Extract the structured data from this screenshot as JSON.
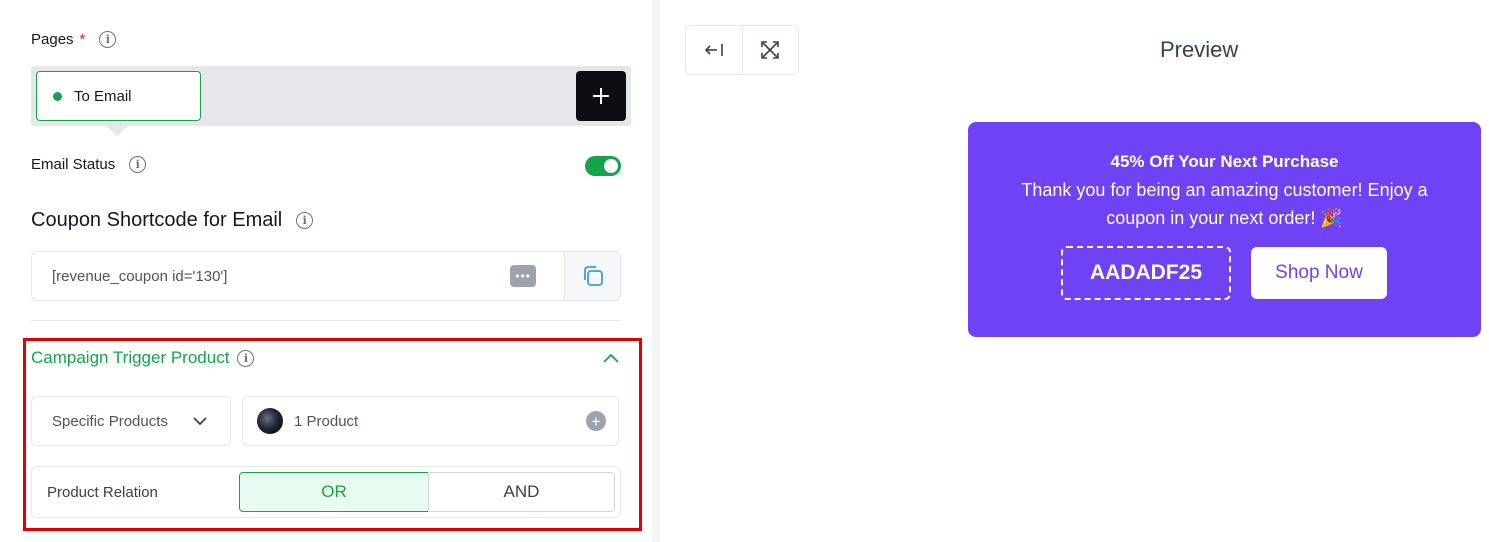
{
  "pages": {
    "label": "Pages",
    "required_mark": "*",
    "tabs": [
      {
        "label": "To Email",
        "active": true
      }
    ],
    "add_icon": "plus-icon"
  },
  "email_status": {
    "label": "Email Status",
    "enabled": true
  },
  "coupon_shortcode": {
    "title": "Coupon Shortcode for Email",
    "value": "[revenue_coupon id='130']",
    "more_icon": "ellipsis-icon",
    "copy_icon": "copy-icon"
  },
  "campaign_trigger": {
    "title": "Campaign Trigger Product",
    "expanded": true,
    "selector_value": "Specific Products",
    "product_count": "1 Product",
    "relation_label": "Product Relation",
    "relation_options": [
      "OR",
      "AND"
    ],
    "relation_selected": "OR"
  },
  "preview": {
    "title": "Preview",
    "toolbar_icons": [
      "collapse-left-icon",
      "expand-icon"
    ],
    "banner": {
      "heading": "45% Off Your Next Purchase",
      "message": "Thank you for being an amazing customer! Enjoy a coupon in your next order! 🎉",
      "coupon_code": "AADADF25",
      "cta_label": "Shop Now",
      "background_color": "#6f42f5"
    }
  },
  "colors": {
    "accent_green": "#16a34a",
    "highlight_red": "#e00000"
  }
}
